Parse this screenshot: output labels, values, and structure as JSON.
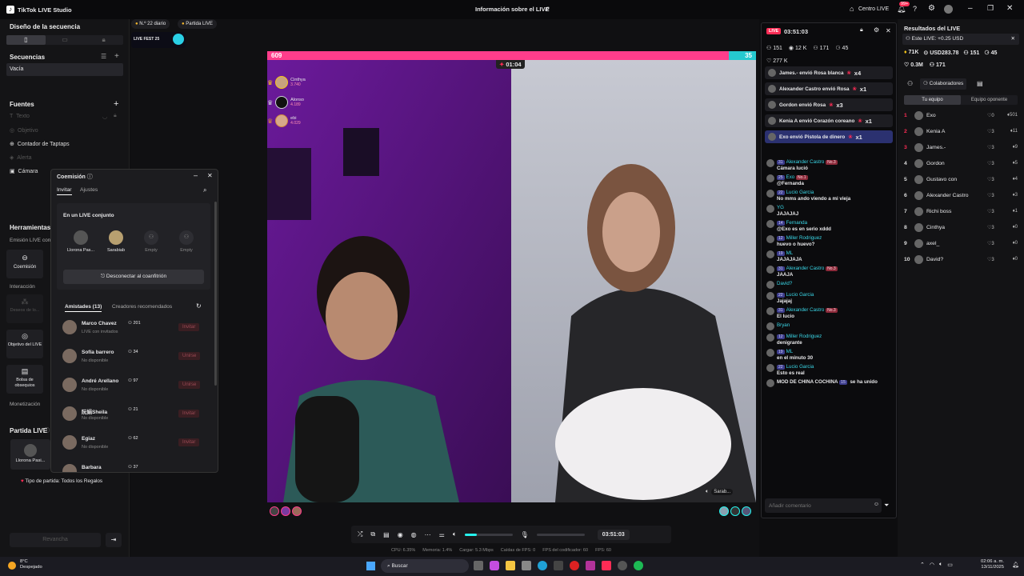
{
  "app": {
    "title": "TikTok LIVE Studio",
    "center_title": "Información sobre el LIVE",
    "centro_live": "Centro LIVE",
    "notif_count": "99+"
  },
  "left": {
    "diseno": "Diseño de la secuencia",
    "secuencias": "Secuencias",
    "vacia": "Vacía",
    "fuentes": "Fuentes",
    "sources": [
      {
        "label": "Texto",
        "disabled": true
      },
      {
        "label": "Objetivo",
        "disabled": true
      },
      {
        "label": "Contador de Taptaps",
        "disabled": false
      },
      {
        "label": "Alerta",
        "disabled": true
      },
      {
        "label": "Cámara",
        "disabled": false
      }
    ],
    "herramientas": "Herramientas",
    "emision": "Emisión LIVE conj",
    "coemision_tool": "Coemisión",
    "interaccion": "Interacción",
    "deseos": "Deseos de lo...",
    "objetivo_live": "Objetivo del LIVE",
    "bolsa": "Bolsa de obsequios",
    "monetizacion": "Monetización",
    "partida": "Partida LIVE",
    "partida_user": "Llorona Pasi...",
    "tipo_partida": "Tipo de partida: Todos los Regalos",
    "revancha": "Revancha"
  },
  "top_badges": {
    "daily": "N.º 22 diario",
    "partida": "Partida LIVE",
    "fest": "LIVE FEST 25"
  },
  "coemision": {
    "title": "Coemisión",
    "tab_invitar": "Invitar",
    "tab_ajustes": "Ajustes",
    "en_live": "En un LIVE conjunto",
    "slots": [
      "Llorona Pas...",
      "Sarabiab",
      "Empty",
      "Empty"
    ],
    "disconnect": "Desconectar al coanfitrión",
    "amistades": "Amistades (13)",
    "recomendados": "Creadores recomendados",
    "friends": [
      {
        "name": "Marco Chavez",
        "count": "201",
        "status": "LIVE con invitados",
        "action": "Invitar"
      },
      {
        "name": "Sofía barrero",
        "count": "34",
        "status": "No disponible",
        "action": "Unirse"
      },
      {
        "name": "André Arellano",
        "count": "97",
        "status": "No disponible",
        "action": "Unirse"
      },
      {
        "name": "阮娟Sheila",
        "count": "21",
        "status": "No disponible",
        "action": "Invitar"
      },
      {
        "name": "Egiaz",
        "count": "62",
        "status": "No disponible",
        "action": "Invitar"
      },
      {
        "name": "Barbara",
        "count": "37",
        "status": "",
        "action": ""
      }
    ]
  },
  "battle": {
    "score_left": "609",
    "score_right": "35",
    "timer": "01:04",
    "gifters": [
      {
        "name": "Cinthya",
        "score": "3.740"
      },
      {
        "name": "Alonso",
        "score": "4.189"
      },
      {
        "name": "ebi",
        "score": "4.029"
      }
    ],
    "cohost_label": "Sarab..."
  },
  "controls": {
    "time": "03:51:03",
    "volume_pct": 25
  },
  "stats": {
    "cpu": "CPU: 6.35%",
    "mem": "Memoria: 1.4%",
    "carga": "Cargar: 5.3 Mbps",
    "caidas": "Caídas de FPS: 0",
    "enc": "FPS del codificador: 60",
    "fps": "FPS: 60"
  },
  "chat": {
    "live_badge": "LIVE",
    "time": "03:51:03",
    "viewers": "151",
    "likes": "12 K",
    "stat3": "171",
    "stat4": "45",
    "hearts": "277 K",
    "gifts": [
      {
        "text": "James.- envió Rosa blanca",
        "mult": "x4",
        "hl": false
      },
      {
        "text": "Alexander Castro envió Rosa",
        "mult": "x1",
        "hl": false
      },
      {
        "text": "Gordon envió Rosa",
        "mult": "x3",
        "hl": false
      },
      {
        "text": "Kenia A envió Corazón coreano",
        "mult": "x1",
        "hl": false
      },
      {
        "text": "Exo envió Pistola de dinero",
        "mult": "x1",
        "hl": true
      }
    ],
    "messages": [
      {
        "lvl": "31",
        "user": "Alexander Castro",
        "rank": "No.3",
        "text": "Cámara lució"
      },
      {
        "lvl": "25",
        "user": "Exo",
        "rank": "No.1",
        "text": "@Fernanda"
      },
      {
        "lvl": "22",
        "user": "Lucio Garcia",
        "rank": "",
        "text": "No mms ando viendo a mi vieja"
      },
      {
        "lvl": "",
        "user": "YG",
        "rank": "",
        "text": "JAJAJAJ"
      },
      {
        "lvl": "14",
        "user": "Fernanda",
        "rank": "",
        "text": "@Exo es en serio xddd"
      },
      {
        "lvl": "12",
        "user": "Miller Rodriguez",
        "rank": "",
        "text": "huevo o huevo?"
      },
      {
        "lvl": "19",
        "user": "ML",
        "rank": "",
        "text": "JAJAJAJA"
      },
      {
        "lvl": "31",
        "user": "Alexander Castro",
        "rank": "No.3",
        "text": "JAAJA"
      },
      {
        "lvl": "",
        "user": "David?",
        "rank": "",
        "text": ""
      },
      {
        "lvl": "22",
        "user": "Lucio Garcia",
        "rank": "",
        "text": "Jajajaj"
      },
      {
        "lvl": "31",
        "user": "Alexander Castro",
        "rank": "No.3",
        "text": "El lucio"
      },
      {
        "lvl": "",
        "user": "Bryan",
        "rank": "",
        "text": ""
      },
      {
        "lvl": "12",
        "user": "Miller Rodriguez",
        "rank": "",
        "text": "denigrante"
      },
      {
        "lvl": "19",
        "user": "ML",
        "rank": "",
        "text": "en el minuto 30"
      },
      {
        "lvl": "22",
        "user": "Lucio Garcia",
        "rank": "",
        "text": "Esto es real"
      }
    ],
    "last": {
      "user": "MOD DE CHINA COCHINA",
      "lvl": "15",
      "text": "se ha unido"
    },
    "input_placeholder": "Añadir comentario"
  },
  "results": {
    "title": "Resultados del LIVE",
    "este_live": "Este LIVE: +0.25 USD",
    "s1": "71K",
    "s2": "USD283.78",
    "s3": "151",
    "s4": "45",
    "s5": "0.3M",
    "s6": "171",
    "colab": "Colaboradores",
    "tab_team": "Tu equipo",
    "tab_opp": "Equipo oponente",
    "ranking": [
      {
        "rank": "1",
        "name": "Exo",
        "a": "0",
        "b": "501"
      },
      {
        "rank": "2",
        "name": "Kenia A",
        "a": "3",
        "b": "11"
      },
      {
        "rank": "3",
        "name": "James.-",
        "a": "3",
        "b": "9"
      },
      {
        "rank": "4",
        "name": "Gordon",
        "a": "3",
        "b": "5"
      },
      {
        "rank": "5",
        "name": "Gustavo con",
        "a": "3",
        "b": "4"
      },
      {
        "rank": "6",
        "name": "Alexander Castro",
        "a": "3",
        "b": "3"
      },
      {
        "rank": "7",
        "name": "Richi boss",
        "a": "3",
        "b": "1"
      },
      {
        "rank": "8",
        "name": "Cinthya",
        "a": "3",
        "b": "0"
      },
      {
        "rank": "9",
        "name": "axel_",
        "a": "3",
        "b": "0"
      },
      {
        "rank": "10",
        "name": "David?",
        "a": "3",
        "b": "0"
      }
    ]
  },
  "taskbar": {
    "weather_temp": "8°C",
    "weather_desc": "Despejado",
    "search": "Buscar",
    "time": "02:06 a. m.",
    "date": "13/11/2025"
  },
  "colors": {
    "accent": "#fe2c55",
    "cyan": "#25f4ee",
    "bar_left": "#ff3d8b",
    "bar_right": "#1fd1c8"
  }
}
